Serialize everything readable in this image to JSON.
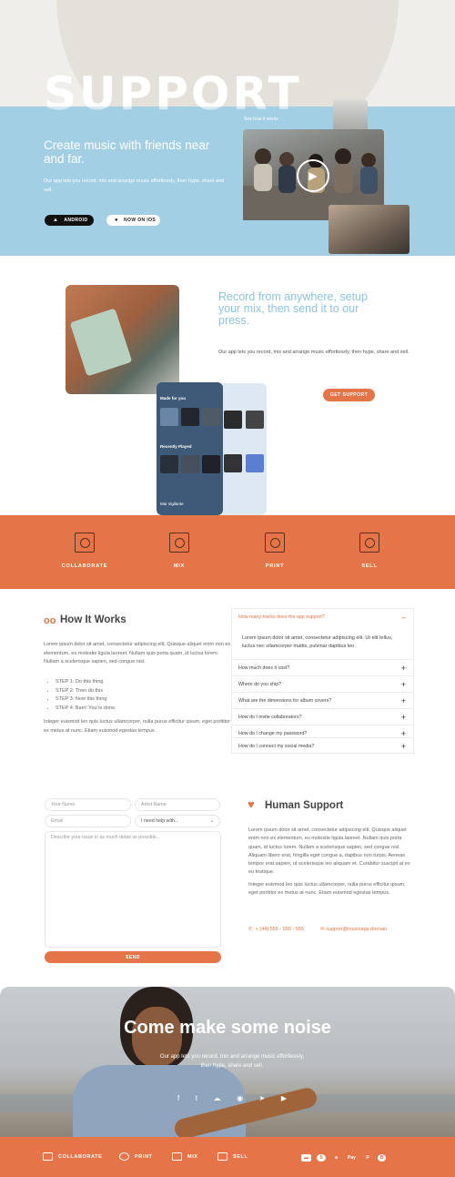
{
  "hero": {
    "big_word": "SUPPORT",
    "see_how": "See how it works",
    "heading": "Create music with friends near and far.",
    "text": "Our app lets you record, mix and arrange music effortlessly, then hype, share and sell.",
    "android_label": "ANDROID",
    "ios_label": "NOW ON IOS"
  },
  "record": {
    "heading": "Record from anywhere, setup your mix, then send it to our press.",
    "text": "Our app lets you record, mix and arrange music effortlessly, then hype, share and sell.",
    "button": "GET SUPPORT",
    "phone": {
      "made_for_you": "Made for you",
      "recently_played": "Recently Played",
      "now_playing": "Mai Vigilante"
    }
  },
  "features": [
    {
      "label": "COLLABORATE",
      "icon": "collaborate-icon"
    },
    {
      "label": "MIX",
      "icon": "mix-icon"
    },
    {
      "label": "PRINT",
      "icon": "print-icon"
    },
    {
      "label": "SELL",
      "icon": "sell-icon"
    }
  ],
  "how_it_works": {
    "title": "How It Works",
    "p1": "Lorem ipsum dolor sit amet, consectetur adipiscing elit. Quisque aliquet enim non ex elementum, eu molestie ligula laoreet. Nullam quis porta quam, id luctus lorem. Nullam a scelerisque sapien, sed congue nisl.",
    "steps": [
      "STEP 1:  Do this thing",
      "STEP 2: Then do this",
      "STEP 3: Now this thing",
      "STEP 4: Bam! You're done."
    ],
    "p2": "Integer euismod leo quis luctus ullamcorper, nulla purus efficitur ipsum, eget porttitor ex metus at nunc. Etiam euismod egestas tempus."
  },
  "faq": {
    "open_question": "How many tracks does the app support?",
    "open_answer": "Lorem ipsum dolor sit amet, consectetur adipiscing elit. Ut elit tellus, luctus nec ullamcorper mattis, pulvinar dapibus leo.",
    "questions": [
      "How much does it cost?",
      "Where do you ship?",
      "What are the dimensions for album covers?",
      "How do I invite collaborators?",
      "How do I change my password?",
      "How do I connect my social media?"
    ]
  },
  "form": {
    "name_placeholder": "Your Name",
    "artist_placeholder": "Artist Name",
    "email_placeholder": "Email",
    "help_selected": "I need help with...",
    "issue_placeholder": "Describe your issue in as much detail as possible...",
    "send_label": "SEND"
  },
  "human_support": {
    "title": "Human Support",
    "p1": "Lorem ipsum dolor sit amet, consectetur adipiscing elit. Quisque aliquet enim non ex elementum, eu molestie ligula laoreet. Nullam quis porta quam, id luctus lorem. Nullam a scelerisque sapien, sed congue nisl. Aliquam libero erat, fringilla eget congue a, dapibus non turpis. Aenean tempor erat sapien, ut scelerisque leo aliquam et. Curabitur suscipit at ex eu tristique.",
    "p2": "Integer euismod leo quis luctus ullamcorper, nulla purus efficitur ipsum, eget porttitor ex metus at nunc. Etiam euismod egestas tempus.",
    "phone": "+ (44) 555 - 555 - 555",
    "email": "support@musicapp.domain"
  },
  "cta": {
    "title": "Come make some noise",
    "text": "Our app lets you record, mix and arrange music effortlessly, then hype, share and sell."
  },
  "footer": {
    "nav": [
      "COLLABORATE",
      "PRINT",
      "MIX",
      "SELL"
    ],
    "payments": [
      "card",
      "stripe",
      "amazon-pay",
      "apple-pay",
      "paypal",
      "bitcoin"
    ]
  },
  "colors": {
    "accent": "#e57548",
    "sky": "#a3cfe5",
    "heading_blue": "#8dc3de"
  }
}
